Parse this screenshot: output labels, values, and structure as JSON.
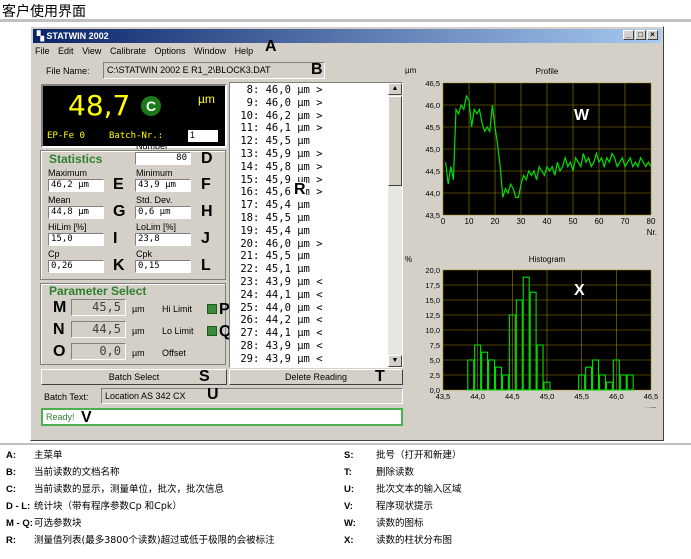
{
  "page_title": "客户使用界面",
  "window": {
    "title": "STATWIN 2002",
    "menu": [
      "File",
      "Edit",
      "View",
      "Calibrate",
      "Options",
      "Window",
      "Help"
    ]
  },
  "file_name": {
    "label": "File Name:",
    "value": "C:\\STATWIN 2002 E R1_2\\BLOCK3.DAT"
  },
  "reading": {
    "value": "48,7",
    "class": "C",
    "unit": "µm",
    "ep_info": "EP-Fe 0",
    "batch_label": "Batch-Nr.:",
    "batch_nr": "1"
  },
  "statistics": {
    "title": "Statistics",
    "number_label": "Number",
    "number": "80",
    "maximum_label": "Maximum",
    "maximum": "46,2 µm",
    "minimum_label": "Minimum",
    "minimum": "43,9 µm",
    "mean_label": "Mean",
    "mean": "44,8 µm",
    "stddev_label": "Std. Dev.",
    "stddev": "0,6 µm",
    "hilim_label": "HiLim [%]",
    "hilim": "15,0",
    "lolim_label": "LoLim [%]",
    "lolim": "23,8",
    "cp_label": "Cp",
    "cp": "0,26",
    "cpk_label": "Cpk",
    "cpk": "0,15"
  },
  "parameter_select": {
    "title": "Parameter Select",
    "hi_value": "45,5",
    "hi_unit": "µm",
    "hi_label": "Hi Limit",
    "lo_value": "44,5",
    "lo_unit": "µm",
    "lo_label": "Lo Limit",
    "offset_value": "0,0",
    "offset_unit": "µm",
    "offset_label": "Offset"
  },
  "readings": [
    {
      "n": "8:",
      "v": "46,0",
      "u": "µm",
      "f": ">"
    },
    {
      "n": "9:",
      "v": "46,0",
      "u": "µm",
      "f": ">"
    },
    {
      "n": "10:",
      "v": "46,2",
      "u": "µm",
      "f": ">"
    },
    {
      "n": "11:",
      "v": "46,1",
      "u": "µm",
      "f": ">"
    },
    {
      "n": "12:",
      "v": "45,5",
      "u": "µm",
      "f": ""
    },
    {
      "n": "13:",
      "v": "45,9",
      "u": "µm",
      "f": ">"
    },
    {
      "n": "14:",
      "v": "45,8",
      "u": "µm",
      "f": ">"
    },
    {
      "n": "15:",
      "v": "45,9",
      "u": "µm",
      "f": ">"
    },
    {
      "n": "16:",
      "v": "45,6",
      "u": "µm",
      "f": ">"
    },
    {
      "n": "17:",
      "v": "45,4",
      "u": "µm",
      "f": ""
    },
    {
      "n": "18:",
      "v": "45,5",
      "u": "µm",
      "f": ""
    },
    {
      "n": "19:",
      "v": "45,4",
      "u": "µm",
      "f": ""
    },
    {
      "n": "20:",
      "v": "46,0",
      "u": "µm",
      "f": ">"
    },
    {
      "n": "21:",
      "v": "45,5",
      "u": "µm",
      "f": ""
    },
    {
      "n": "22:",
      "v": "45,1",
      "u": "µm",
      "f": ""
    },
    {
      "n": "23:",
      "v": "43,9",
      "u": "µm",
      "f": "<"
    },
    {
      "n": "24:",
      "v": "44,1",
      "u": "µm",
      "f": "<"
    },
    {
      "n": "25:",
      "v": "44,0",
      "u": "µm",
      "f": "<"
    },
    {
      "n": "26:",
      "v": "44,2",
      "u": "µm",
      "f": "<"
    },
    {
      "n": "27:",
      "v": "44,1",
      "u": "µm",
      "f": "<"
    },
    {
      "n": "28:",
      "v": "43,9",
      "u": "µm",
      "f": "<"
    },
    {
      "n": "29:",
      "v": "43,9",
      "u": "µm",
      "f": "<"
    }
  ],
  "buttons": {
    "batch_select": "Batch Select",
    "delete_reading": "Delete Reading"
  },
  "batch_text": {
    "label": "Batch Text:",
    "value": "Location AS 342 CX"
  },
  "status": "Ready!",
  "colors": {
    "plot_bg": "#000000",
    "plot_line": "#00e000",
    "grid": "#a08000",
    "reading_text": "#ffff00",
    "title_blue": "#0a246a",
    "accent_green": "#2f7f2f"
  },
  "callouts": [
    "A",
    "B",
    "C",
    "D",
    "E",
    "F",
    "G",
    "H",
    "I",
    "J",
    "K",
    "L",
    "M",
    "N",
    "O",
    "P",
    "Q",
    "R",
    "S",
    "T",
    "U",
    "V",
    "W",
    "X"
  ],
  "chart_data": [
    {
      "type": "line",
      "title": "Profile",
      "ylabel": "µm",
      "xlabel": "Nr.",
      "xlim": [
        0,
        80
      ],
      "ylim": [
        43.5,
        46.5
      ],
      "x_ticks": [
        "0",
        "10",
        "20",
        "30",
        "40",
        "50",
        "60",
        "70",
        "80"
      ],
      "y_ticks": [
        "43,5",
        "44,0",
        "44,5",
        "45,0",
        "45,5",
        "46,0",
        "46,5"
      ],
      "grid": true,
      "y": [
        44.7,
        44.2,
        44.6,
        44.3,
        45.9,
        45.8,
        46.0,
        45.9,
        46.2,
        46.1,
        45.5,
        45.9,
        45.8,
        45.9,
        45.6,
        45.4,
        45.5,
        45.4,
        46.0,
        45.5,
        45.1,
        44.6,
        43.9,
        44.1,
        44.0,
        44.2,
        44.1,
        43.9,
        43.9,
        44.2,
        44.4,
        44.3,
        44.5,
        44.4,
        44.5,
        44.3,
        44.6,
        44.5,
        44.4,
        44.6,
        44.5,
        44.6,
        44.4,
        44.7,
        44.5,
        44.6,
        44.8,
        44.6,
        44.7,
        44.5,
        44.8,
        44.7,
        44.6,
        44.9,
        44.7,
        44.8,
        44.6,
        44.7,
        44.9,
        44.7,
        44.8,
        44.6,
        44.8,
        44.7,
        44.9,
        44.8,
        44.6,
        44.7,
        44.8,
        44.6,
        44.7,
        44.8,
        44.6,
        44.7,
        44.6,
        44.8,
        44.7,
        44.6,
        44.7,
        44.6
      ]
    },
    {
      "type": "bar",
      "title": "Histogram",
      "ylabel": "%",
      "xlabel": "µm",
      "xlim": [
        43.5,
        46.5
      ],
      "ylim": [
        0,
        20
      ],
      "x_ticks": [
        "43,5",
        "44,0",
        "44,5",
        "45,0",
        "45,5",
        "46,0",
        "46,5"
      ],
      "y_ticks": [
        "0,0",
        "2,5",
        "5,0",
        "7,5",
        "10,0",
        "12,5",
        "15,0",
        "17,5",
        "20,0"
      ],
      "grid": true,
      "bins": [
        43.9,
        44.0,
        44.1,
        44.2,
        44.3,
        44.4,
        44.5,
        44.6,
        44.7,
        44.8,
        44.9,
        45.0,
        45.1,
        45.2,
        45.3,
        45.4,
        45.5,
        45.6,
        45.7,
        45.8,
        45.9,
        46.0,
        46.1,
        46.2
      ],
      "values": [
        5.0,
        7.5,
        6.3,
        5.0,
        3.8,
        2.5,
        12.5,
        15.0,
        18.8,
        16.3,
        7.5,
        1.3,
        0,
        0,
        0,
        0,
        2.5,
        3.8,
        5.0,
        2.5,
        1.3,
        5.0,
        2.5,
        2.5
      ]
    }
  ],
  "legend": {
    "left": [
      {
        "k": "A:",
        "t": "主菜单"
      },
      {
        "k": "B:",
        "t": "当前读数的文档名称"
      },
      {
        "k": "C:",
        "t": "当前读数的显示，测量单位，批次，批次信息"
      },
      {
        "k": "D - L:",
        "t": "统计块（带有程序参数Cp 和Cpk）"
      },
      {
        "k": "M - Q:",
        "t": "可选参数块"
      },
      {
        "k": "R:",
        "t": "测量值列表(最多3800个读数)超过或低于极限的会被标注"
      }
    ],
    "right": [
      {
        "k": "S:",
        "t": "批号（打开和新建）"
      },
      {
        "k": "T:",
        "t": "删除读数"
      },
      {
        "k": "U:",
        "t": "批次文本的输入区域"
      },
      {
        "k": "V:",
        "t": "程序现状提示"
      },
      {
        "k": "W:",
        "t": "读数的图标"
      },
      {
        "k": "X:",
        "t": "读数的柱状分布图"
      }
    ]
  }
}
